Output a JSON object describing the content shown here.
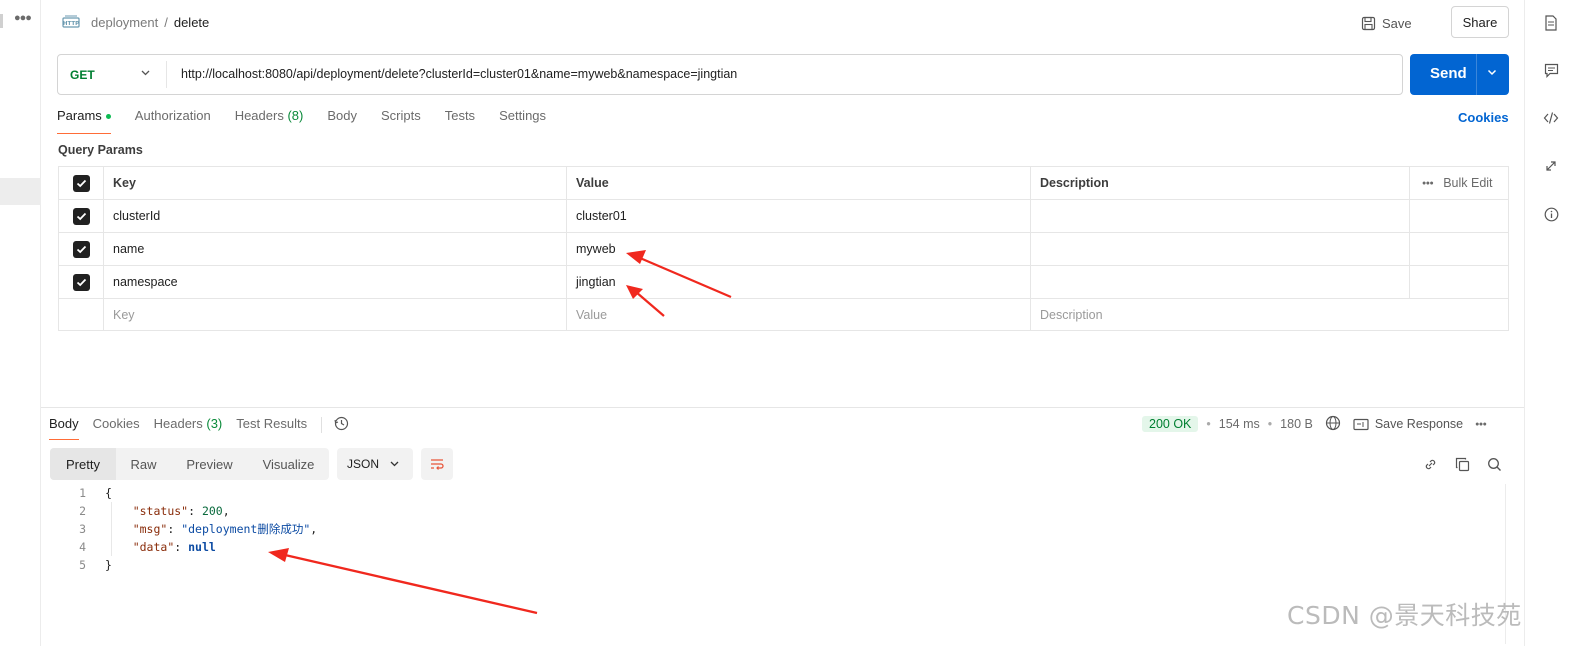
{
  "header": {
    "breadcrumb_parent": "deployment",
    "breadcrumb_sep": "/",
    "breadcrumb_current": "delete",
    "save_label": "Save",
    "share_label": "Share"
  },
  "request": {
    "method": "GET",
    "url": "http://localhost:8080/api/deployment/delete?clusterId=cluster01&name=myweb&namespace=jingtian",
    "send_label": "Send"
  },
  "request_tabs": [
    {
      "label": "Params",
      "active": true
    },
    {
      "label": "Authorization"
    },
    {
      "label": "Headers",
      "count": "(8)"
    },
    {
      "label": "Body"
    },
    {
      "label": "Scripts"
    },
    {
      "label": "Tests"
    },
    {
      "label": "Settings"
    }
  ],
  "cookies_link": "Cookies",
  "query_params": {
    "title": "Query Params",
    "headers": {
      "key": "Key",
      "value": "Value",
      "description": "Description",
      "bulk_edit": "Bulk Edit"
    },
    "rows": [
      {
        "key": "clusterId",
        "value": "cluster01",
        "checked": true
      },
      {
        "key": "name",
        "value": "myweb",
        "checked": true
      },
      {
        "key": "namespace",
        "value": "jingtian",
        "checked": true
      }
    ],
    "placeholder": {
      "key": "Key",
      "value": "Value",
      "description": "Description"
    }
  },
  "response_tabs": [
    {
      "label": "Body",
      "active": true
    },
    {
      "label": "Cookies"
    },
    {
      "label": "Headers",
      "count": "(3)"
    },
    {
      "label": "Test Results"
    }
  ],
  "response_meta": {
    "status": "200 OK",
    "time": "154 ms",
    "size": "180 B",
    "save_response": "Save Response",
    "status_color": "#007f31"
  },
  "view_modes": [
    "Pretty",
    "Raw",
    "Preview",
    "Visualize"
  ],
  "format": "JSON",
  "code_lines": {
    "l1": {
      "num": "1",
      "text": "{"
    },
    "l2": {
      "num": "2",
      "key": "\"status\"",
      "colon": ": ",
      "value": "200",
      "tail": ","
    },
    "l3": {
      "num": "3",
      "key": "\"msg\"",
      "colon": ": ",
      "value": "\"deployment删除成功\"",
      "tail": ","
    },
    "l4": {
      "num": "4",
      "key": "\"data\"",
      "colon": ": ",
      "value": "null",
      "tail": ""
    },
    "l5": {
      "num": "5",
      "text": "}"
    }
  },
  "watermark": "CSDN @景天科技苑",
  "colors": {
    "accent": "#0265d2",
    "tab_underline": "#ff6c37",
    "annotation_arrow": "#f0281e"
  }
}
